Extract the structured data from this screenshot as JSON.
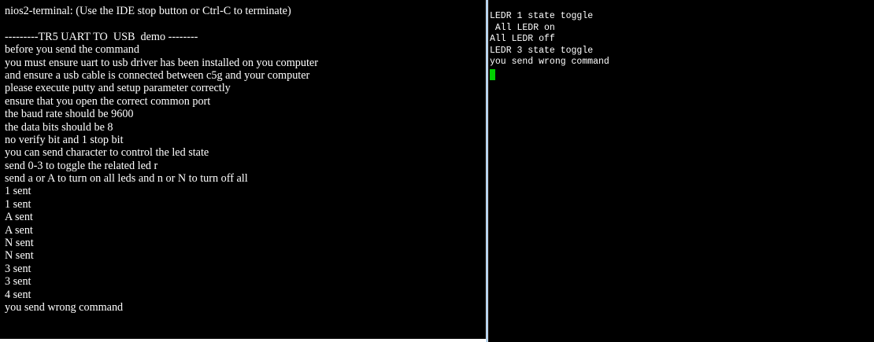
{
  "left_terminal": {
    "lines": [
      "nios2-terminal: (Use the IDE stop button or Ctrl-C to terminate)",
      "",
      "---------TR5 UART TO  USB  demo --------",
      "before you send the command",
      "you must ensure uart to usb driver has been installed on you computer",
      "and ensure a usb cable is connected between c5g and your computer",
      "please execute putty and setup parameter correctly",
      "ensure that you open the correct common port",
      "the baud rate should be 9600",
      "the data bits should be 8",
      "no verify bit and 1 stop bit",
      "you can send character to control the led state",
      "send 0-3 to toggle the related led r",
      "send a or A to turn on all leds and n or N to turn off all",
      "1 sent",
      "1 sent",
      "A sent",
      "A sent",
      "N sent",
      "N sent",
      "3 sent",
      "3 sent",
      "4 sent",
      "you send wrong command"
    ]
  },
  "right_terminal": {
    "lines": [
      "LEDR 1 state toggle",
      " All LEDR on",
      "All LEDR off",
      "LEDR 3 state toggle",
      "you send wrong command"
    ],
    "cursor_color": "#00d000"
  },
  "colors": {
    "terminal_bg": "#000000",
    "terminal_fg": "#ffffff",
    "divider_accent": "#5b9bd5"
  }
}
